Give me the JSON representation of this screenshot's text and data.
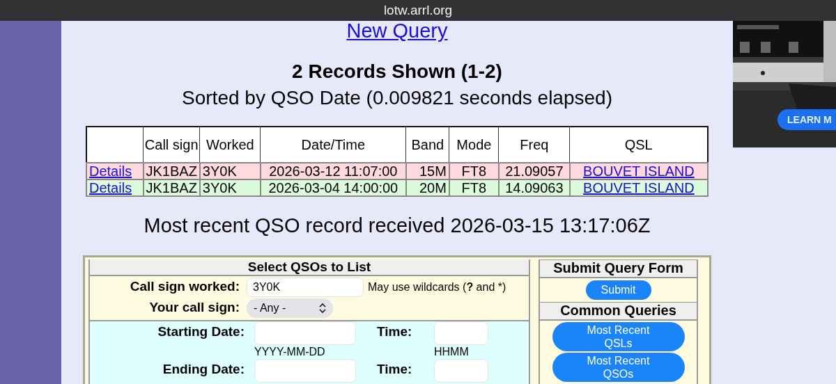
{
  "browser": {
    "url": "lotw.arrl.org"
  },
  "new_query_link": "New Query",
  "summary": {
    "title": "2 Records Shown (1-2)",
    "subtitle": "Sorted by QSO Date (0.009821 seconds elapsed)"
  },
  "table": {
    "columns": [
      "Call sign",
      "Worked",
      "Date/Time",
      "Band",
      "Mode",
      "Freq",
      "QSL"
    ],
    "rows": [
      {
        "details": "Details",
        "call_sign": "JK1BAZ",
        "worked": "3Y0K",
        "date_time": "2026-03-12 11:07:00",
        "band": "15M",
        "mode": "FT8",
        "freq": "21.09057",
        "qsl": "BOUVET ISLAND",
        "color": "#ffd9de"
      },
      {
        "details": "Details",
        "call_sign": "JK1BAZ",
        "worked": "3Y0K",
        "date_time": "2026-03-04 14:00:00",
        "band": "20M",
        "mode": "FT8",
        "freq": "14.09063",
        "qsl": "BOUVET ISLAND",
        "color": "#dcfbdc"
      }
    ]
  },
  "latest": "Most recent QSO record received 2026-03-15 13:17:06Z",
  "form": {
    "title": "Select QSOs to List",
    "fields": [
      {
        "kind": "text",
        "label": "Call sign worked:",
        "value": "3Y0K",
        "hint": "May use wildcards (**?** and *)"
      },
      {
        "kind": "select",
        "label": "Your call sign:",
        "value": "- Any -"
      }
    ],
    "dates": [
      {
        "label": "Starting Date:",
        "date_hint": "YYYY-MM-DD",
        "time_label": "Time:",
        "time_hint": "HHMM"
      },
      {
        "label": "Ending Date:",
        "time_label": "Time:"
      }
    ]
  },
  "submit_panel": {
    "title": "Submit Query Form",
    "button": "Submit",
    "common_title": "Common Queries",
    "buttons": [
      "Most Recent QSLs",
      "Most Recent QSOs"
    ]
  },
  "ad": {
    "kind": "picture",
    "button": "LEARN M"
  }
}
